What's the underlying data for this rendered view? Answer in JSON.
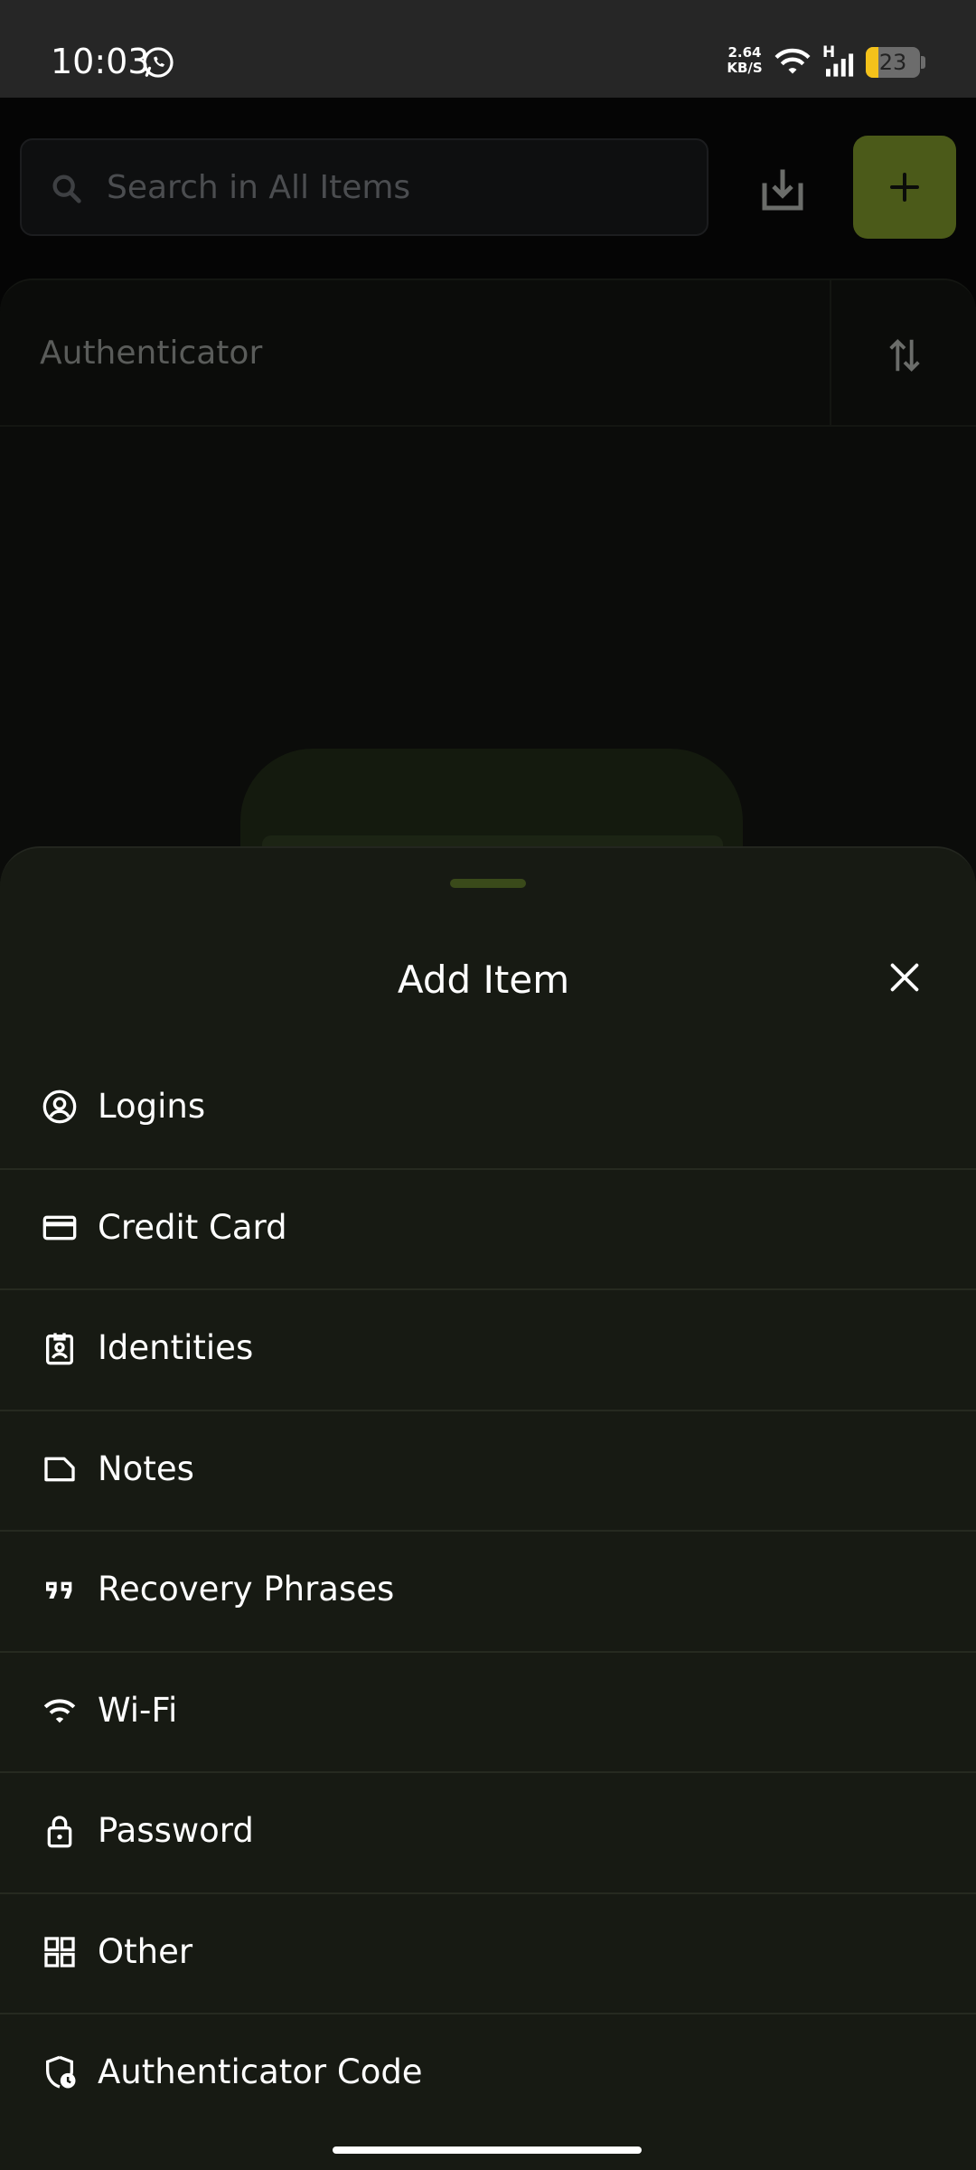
{
  "status_bar": {
    "time": "10:03",
    "network_speed_value": "2.64",
    "network_speed_unit": "KB/S",
    "signal_type": "H",
    "battery_level": "23",
    "battery_color": "#f4c21b",
    "icons": [
      "whatsapp-icon",
      "wifi-icon",
      "cellular-signal-icon",
      "battery-icon"
    ]
  },
  "background": {
    "search_placeholder": "Search in All Items",
    "section_title": "Authenticator",
    "accent_color": "#4b5a19",
    "icons": [
      "search-icon",
      "import-icon",
      "plus-icon",
      "sort-icon"
    ]
  },
  "sheet": {
    "title": "Add Item",
    "close_icon": "close-icon",
    "items": [
      {
        "label": "Logins",
        "icon": "user-circle-icon"
      },
      {
        "label": "Credit Card",
        "icon": "credit-card-icon"
      },
      {
        "label": "Identities",
        "icon": "id-badge-icon"
      },
      {
        "label": "Notes",
        "icon": "note-icon"
      },
      {
        "label": "Recovery Phrases",
        "icon": "quote-icon"
      },
      {
        "label": "Wi-Fi",
        "icon": "wifi-icon"
      },
      {
        "label": "Password",
        "icon": "lock-icon"
      },
      {
        "label": "Other",
        "icon": "grid-icon"
      },
      {
        "label": "Authenticator Code",
        "icon": "shield-clock-icon"
      }
    ]
  }
}
